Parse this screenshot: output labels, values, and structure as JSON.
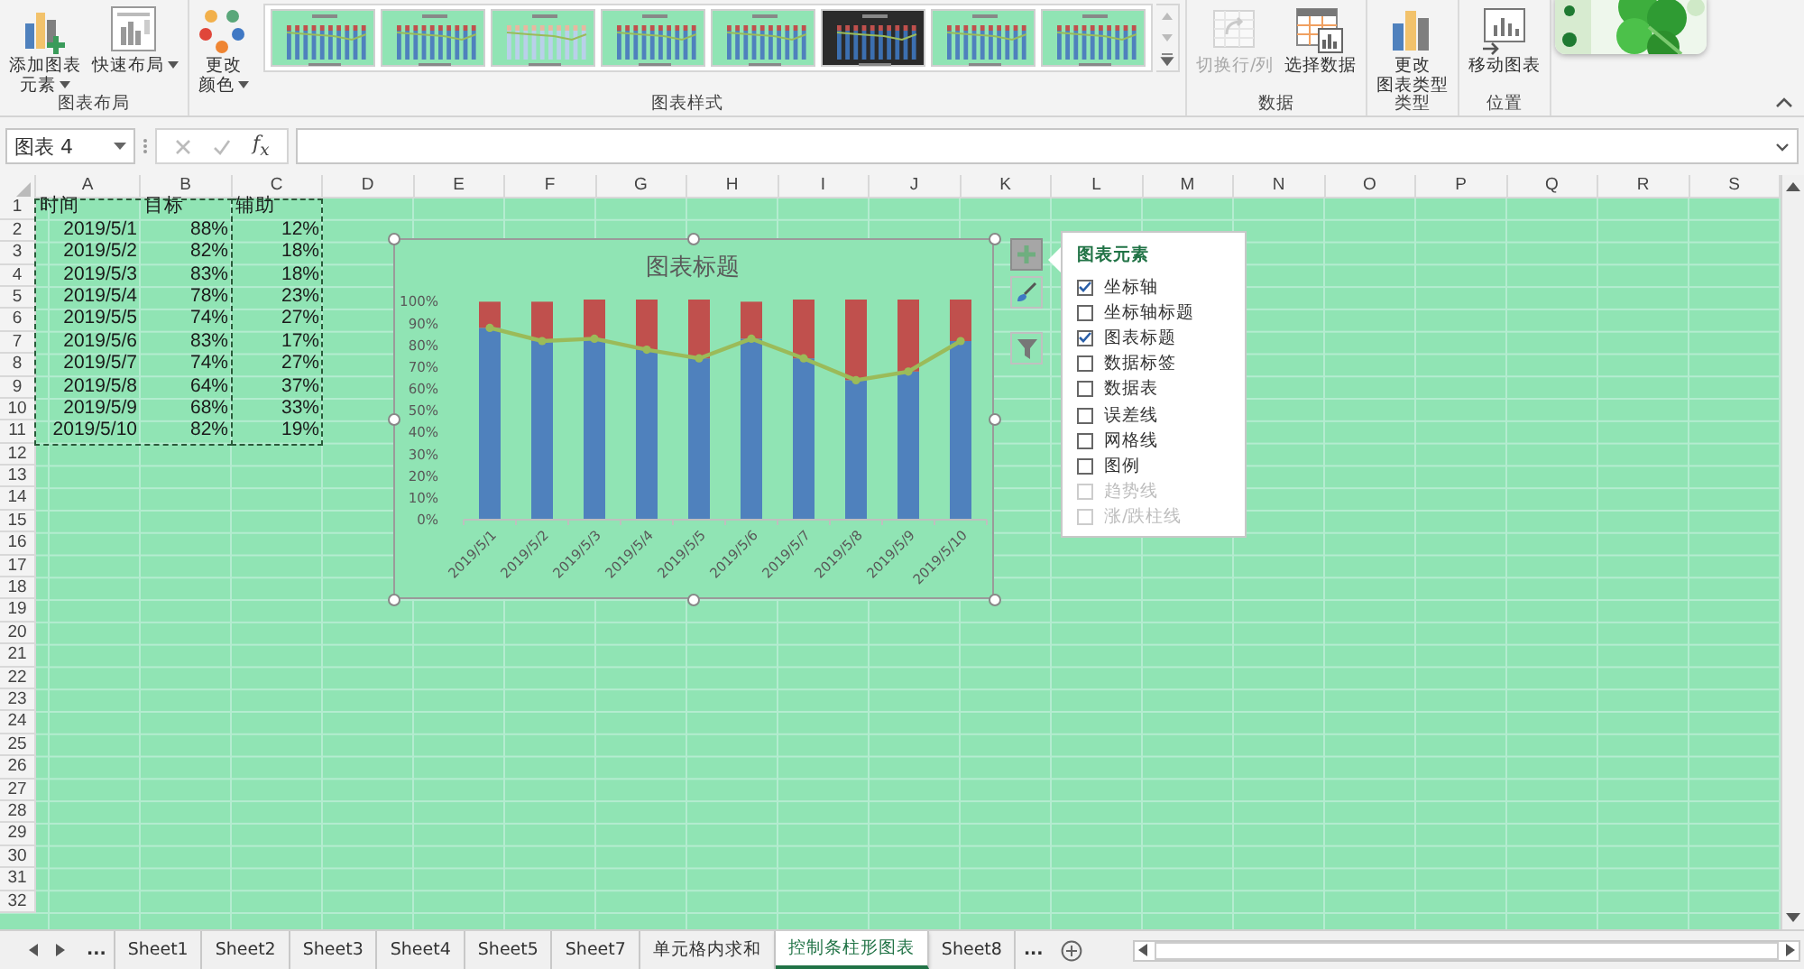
{
  "ribbon": {
    "groups": [
      {
        "label": "图表布局",
        "buttons": [
          {
            "kind": "add-element",
            "lines": [
              "添加图表",
              "元素"
            ],
            "dropdown": true,
            "disabled": false
          },
          {
            "kind": "quick-layout",
            "lines": [
              "快速布局"
            ],
            "dropdown": true,
            "disabled": false
          }
        ]
      },
      {
        "label": "图表样式",
        "buttons": [
          {
            "kind": "colors",
            "lines": [
              "更改",
              "颜色"
            ],
            "dropdown": true,
            "disabled": false
          }
        ],
        "gallery": [
          {
            "kind": "light"
          },
          {
            "kind": "light"
          },
          {
            "kind": "pale"
          },
          {
            "kind": "light"
          },
          {
            "kind": "light"
          },
          {
            "kind": "dark"
          },
          {
            "kind": "light"
          },
          {
            "kind": "light"
          }
        ]
      },
      {
        "label": "数据",
        "buttons": [
          {
            "kind": "switch",
            "lines": [
              "切换行/列"
            ],
            "dropdown": false,
            "disabled": true
          },
          {
            "kind": "select-data",
            "lines": [
              "选择数据"
            ],
            "dropdown": false,
            "disabled": false
          }
        ]
      },
      {
        "label": "类型",
        "buttons": [
          {
            "kind": "chart-type",
            "lines": [
              "更改",
              "图表类型"
            ],
            "dropdown": false,
            "disabled": false
          }
        ]
      },
      {
        "label": "位置",
        "buttons": [
          {
            "kind": "move",
            "lines": [
              "移动图表"
            ],
            "dropdown": false,
            "disabled": false
          }
        ]
      }
    ]
  },
  "formula_bar": {
    "name_box": "图表 4",
    "function_label": "f$_{x}$"
  },
  "sheet": {
    "columns": [
      "A",
      "B",
      "C",
      "D",
      "E",
      "F",
      "G",
      "H",
      "I",
      "J",
      "K",
      "L",
      "M",
      "N",
      "O",
      "P",
      "Q",
      "R",
      "S"
    ],
    "row_numbers": [
      "1",
      "2",
      "3",
      "4",
      "5",
      "6",
      "7",
      "8",
      "9",
      "10",
      "11",
      "12",
      "13",
      "14",
      "15",
      "16",
      "17",
      "18",
      "19",
      "20",
      "21",
      "22",
      "23",
      "24",
      "25",
      "26",
      "27",
      "28",
      "29",
      "30",
      "31",
      "32"
    ],
    "rows": [
      [
        "时间",
        "目标",
        "辅助"
      ],
      [
        "2019/5/1",
        "88%",
        "12%"
      ],
      [
        "2019/5/2",
        "82%",
        "18%"
      ],
      [
        "2019/5/3",
        "83%",
        "18%"
      ],
      [
        "2019/5/4",
        "78%",
        "23%"
      ],
      [
        "2019/5/5",
        "74%",
        "27%"
      ],
      [
        "2019/5/6",
        "83%",
        "17%"
      ],
      [
        "2019/5/7",
        "74%",
        "27%"
      ],
      [
        "2019/5/8",
        "64%",
        "37%"
      ],
      [
        "2019/5/9",
        "68%",
        "33%"
      ],
      [
        "2019/5/10",
        "82%",
        "19%"
      ]
    ]
  },
  "chart": {
    "title": "图表标题",
    "chart_data": {
      "type": "bar",
      "stacked": true,
      "categories": [
        "2019/5/1",
        "2019/5/2",
        "2019/5/3",
        "2019/5/4",
        "2019/5/5",
        "2019/5/6",
        "2019/5/7",
        "2019/5/8",
        "2019/5/9",
        "2019/5/10"
      ],
      "ylim": [
        0,
        1.01
      ],
      "yticks": [
        {
          "value": 0,
          "label": "0%"
        },
        {
          "value": 0.1,
          "label": "10%"
        },
        {
          "value": 0.2,
          "label": "20%"
        },
        {
          "value": 0.3,
          "label": "30%"
        },
        {
          "value": 0.4,
          "label": "40%"
        },
        {
          "value": 0.5,
          "label": "50%"
        },
        {
          "value": 0.6,
          "label": "60%"
        },
        {
          "value": 0.7,
          "label": "70%"
        },
        {
          "value": 0.8,
          "label": "80%"
        },
        {
          "value": 0.9,
          "label": "90%"
        },
        {
          "value": 1,
          "label": "100%"
        }
      ],
      "series": [
        {
          "color": "#4f81bd",
          "values": [
            0.88,
            0.82,
            0.83,
            0.78,
            0.74,
            0.83,
            0.74,
            0.64,
            0.68,
            0.82
          ]
        },
        {
          "color": "#c0504d",
          "values": [
            0.12,
            0.18,
            0.18,
            0.23,
            0.27,
            0.17,
            0.27,
            0.37,
            0.33,
            0.19
          ]
        },
        {
          "type": "line",
          "marker": "circle",
          "color": "#9bbb59",
          "values": [
            0.88,
            0.82,
            0.83,
            0.78,
            0.74,
            0.83,
            0.74,
            0.64,
            0.68,
            0.82
          ]
        }
      ]
    }
  },
  "chart_buttons": [
    {
      "kind": "elements",
      "selected": true
    },
    {
      "kind": "styles",
      "selected": false
    },
    {
      "kind": "filter",
      "selected": false
    }
  ],
  "elements_panel": {
    "title": "图表元素",
    "items": [
      {
        "label": "坐标轴",
        "checked": true,
        "disabled": false
      },
      {
        "label": "坐标轴标题",
        "checked": false,
        "disabled": false
      },
      {
        "label": "图表标题",
        "checked": true,
        "disabled": false
      },
      {
        "label": "数据标签",
        "checked": false,
        "disabled": false
      },
      {
        "label": "数据表",
        "checked": false,
        "disabled": false
      },
      {
        "label": "误差线",
        "checked": false,
        "disabled": false
      },
      {
        "label": "网格线",
        "checked": false,
        "disabled": false
      },
      {
        "label": "图例",
        "checked": false,
        "disabled": false
      },
      {
        "label": "趋势线",
        "checked": false,
        "disabled": true
      },
      {
        "label": "涨/跌柱线",
        "checked": false,
        "disabled": true
      }
    ]
  },
  "sheet_tabs": {
    "leading_more": "...",
    "tabs": [
      {
        "label": "Sheet1",
        "selected": false
      },
      {
        "label": "Sheet2",
        "selected": false
      },
      {
        "label": "Sheet3",
        "selected": false
      },
      {
        "label": "Sheet4",
        "selected": false
      },
      {
        "label": "Sheet5",
        "selected": false
      },
      {
        "label": "Sheet7",
        "selected": false
      },
      {
        "label": "单元格内求和",
        "selected": false
      },
      {
        "label": "控制条柱形图表",
        "selected": true
      },
      {
        "label": "Sheet8",
        "selected": false
      }
    ],
    "trailing_more": "..."
  }
}
